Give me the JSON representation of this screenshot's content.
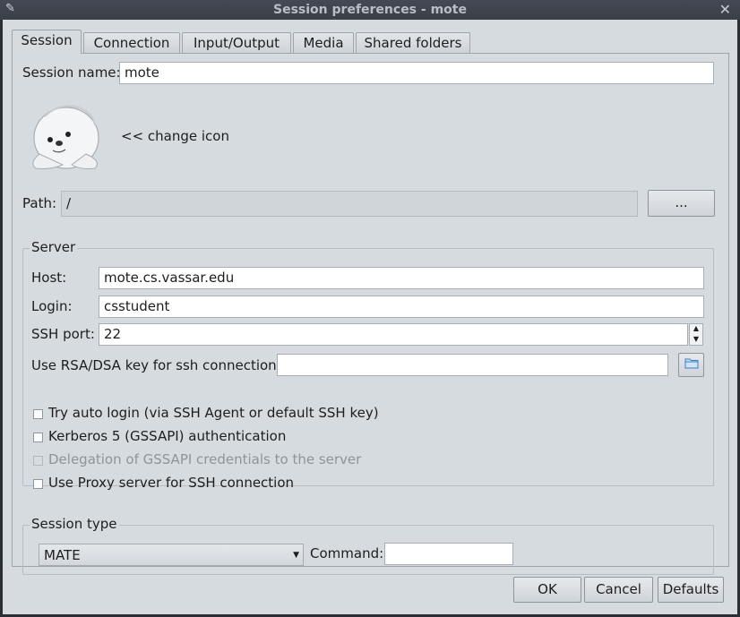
{
  "window": {
    "title": "Session preferences - mote"
  },
  "tabs": [
    {
      "label": "Session"
    },
    {
      "label": "Connection"
    },
    {
      "label": "Input/Output"
    },
    {
      "label": "Media"
    },
    {
      "label": "Shared folders"
    }
  ],
  "session": {
    "name_label": "Session name:",
    "name_value": "mote",
    "change_icon": "<< change icon",
    "path_label": "Path:",
    "path_value": "/",
    "browse_label": "..."
  },
  "server": {
    "title": "Server",
    "host_label": "Host:",
    "host_value": "mote.cs.vassar.edu",
    "login_label": "Login:",
    "login_value": "csstudent",
    "port_label": "SSH port:",
    "port_value": "22",
    "key_label": "Use RSA/DSA key for ssh connection:",
    "key_value": "",
    "options": [
      {
        "label": "Try auto login (via SSH Agent or default SSH key)",
        "checked": false,
        "enabled": true
      },
      {
        "label": "Kerberos 5 (GSSAPI) authentication",
        "checked": false,
        "enabled": true
      },
      {
        "label": "Delegation of GSSAPI credentials to the server",
        "checked": false,
        "enabled": false
      },
      {
        "label": "Use Proxy server for SSH connection",
        "checked": false,
        "enabled": true
      }
    ]
  },
  "session_type": {
    "title": "Session type",
    "selected": "MATE",
    "command_label": "Command:",
    "command_value": ""
  },
  "buttons": {
    "ok": "OK",
    "cancel": "Cancel",
    "defaults": "Defaults"
  }
}
